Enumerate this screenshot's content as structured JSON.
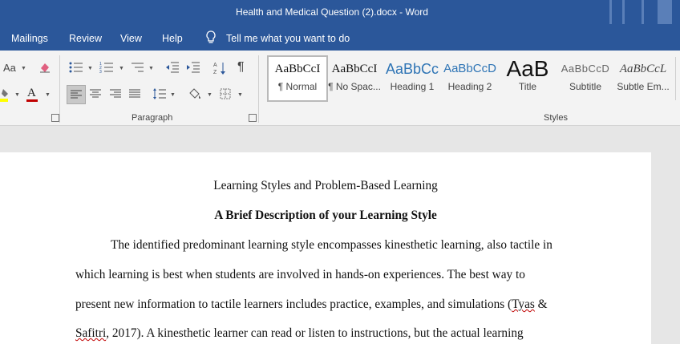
{
  "window": {
    "title": "Health and Medical Question (2).docx  -  Word"
  },
  "menu": {
    "mailings": "Mailings",
    "review": "Review",
    "view": "View",
    "help": "Help",
    "tell_me": "Tell me what you want to do"
  },
  "ribbon": {
    "font_case_label": "Aa",
    "paragraph_group": "Paragraph",
    "styles_group": "Styles",
    "styles": [
      {
        "sample": "AaBbCcI",
        "name": "¶ Normal"
      },
      {
        "sample": "AaBbCcI",
        "name": "¶ No Spac..."
      },
      {
        "sample": "AaBbCc",
        "name": "Heading 1"
      },
      {
        "sample": "AaBbCcD",
        "name": "Heading 2"
      },
      {
        "sample": "AaB",
        "name": "Title"
      },
      {
        "sample": "AaBbCcD",
        "name": "Subtitle"
      },
      {
        "sample": "AaBbCcL",
        "name": "Subtle Em..."
      }
    ]
  },
  "document": {
    "title": "Learning Styles and Problem-Based Learning",
    "heading": "A Brief Description of your Learning Style",
    "lines": [
      "The identified predominant learning style encompasses kinesthetic learning, also tactile in",
      "which learning is best when students are involved in hands-on experiences. The best way to",
      "present new information to tactile learners includes practice, examples, and simulations (",
      "Tyas",
      " &",
      "Safitri",
      ", 2017). A kinesthetic learner can read or listen to instructions, but the actual learning"
    ]
  },
  "colors": {
    "title_bar": "#2b579a",
    "ribbon_bg": "#f3f3f3",
    "page_bg": "#ffffff",
    "font_color_accent": "#c00000",
    "highlight_accent": "#ffff00"
  }
}
